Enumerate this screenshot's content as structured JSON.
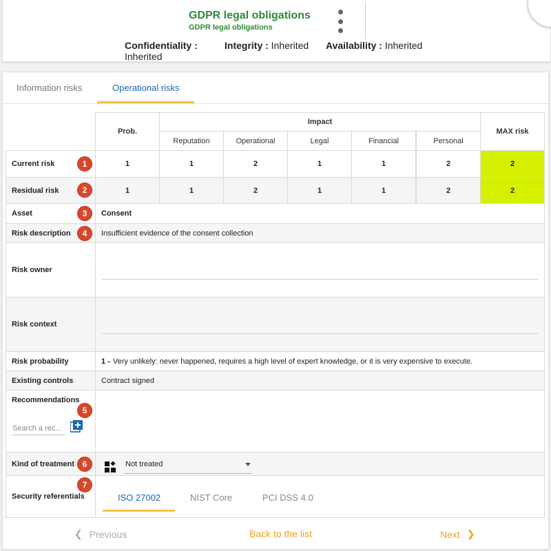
{
  "header": {
    "title": "GDPR legal obligations",
    "subtitle": "GDPR legal obligations",
    "confidentiality_label": "Confidentiality :",
    "confidentiality_value": "Inherited",
    "integrity_label": "Integrity :",
    "integrity_value": "Inherited",
    "availability_label": "Availability :",
    "availability_value": "Inherited"
  },
  "tabs": [
    {
      "label": "Information risks",
      "active": false
    },
    {
      "label": "Operational risks",
      "active": true
    }
  ],
  "table": {
    "prob_header": "Prob.",
    "impact_header": "Impact",
    "max_header": "MAX risk",
    "impact_columns": [
      "Reputation",
      "Operational",
      "Legal",
      "Financial",
      "Personal"
    ],
    "rows": [
      {
        "label": "Current risk",
        "badge": "1",
        "prob": "1",
        "impacts": [
          "1",
          "2",
          "1",
          "1",
          "2"
        ],
        "max": "2"
      },
      {
        "label": "Residual risk",
        "badge": "2",
        "prob": "1",
        "impacts": [
          "1",
          "2",
          "1",
          "1",
          "2"
        ],
        "max": "2"
      }
    ],
    "max_color": "#d4f000"
  },
  "fields": {
    "asset_label": "Asset",
    "asset_badge": "3",
    "asset_value": "Consent",
    "risk_description_label": "Risk description",
    "risk_description_badge": "4",
    "risk_description_value": "Insufficient evidence of the consent collection",
    "risk_owner_label": "Risk owner",
    "risk_owner_value": "",
    "risk_context_label": "Risk context",
    "risk_context_value": "",
    "risk_probability_label": "Risk probability",
    "risk_probability_num": "1 -",
    "risk_probability_value": "Very unlikely: never happened, requires a high level of expert knowledge, or it is very expensive to execute.",
    "existing_controls_label": "Existing controls",
    "existing_controls_value": "Contract signed",
    "recommendations_label": "Recommendations",
    "recommendations_badge": "5",
    "recommendations_search_placeholder": "Search a rec...",
    "treatment_label": "Kind of treatment",
    "treatment_badge": "6",
    "treatment_value": "Not treated",
    "referentials_label": "Security referentials",
    "referentials_badge": "7",
    "referential_tabs": [
      {
        "label": "ISO 27002",
        "active": true
      },
      {
        "label": "NIST Core",
        "active": false
      },
      {
        "label": "PCI DSS 4.0",
        "active": false
      }
    ]
  },
  "footer": {
    "previous": "Previous",
    "back": "Back to the list",
    "next": "Next"
  },
  "colors": {
    "title_green": "#2e8b3a",
    "accent_blue": "#1a66b5",
    "badge_red": "#d9472b",
    "footer_orange": "#f2a01e",
    "tab_underline": "#f5c542"
  }
}
